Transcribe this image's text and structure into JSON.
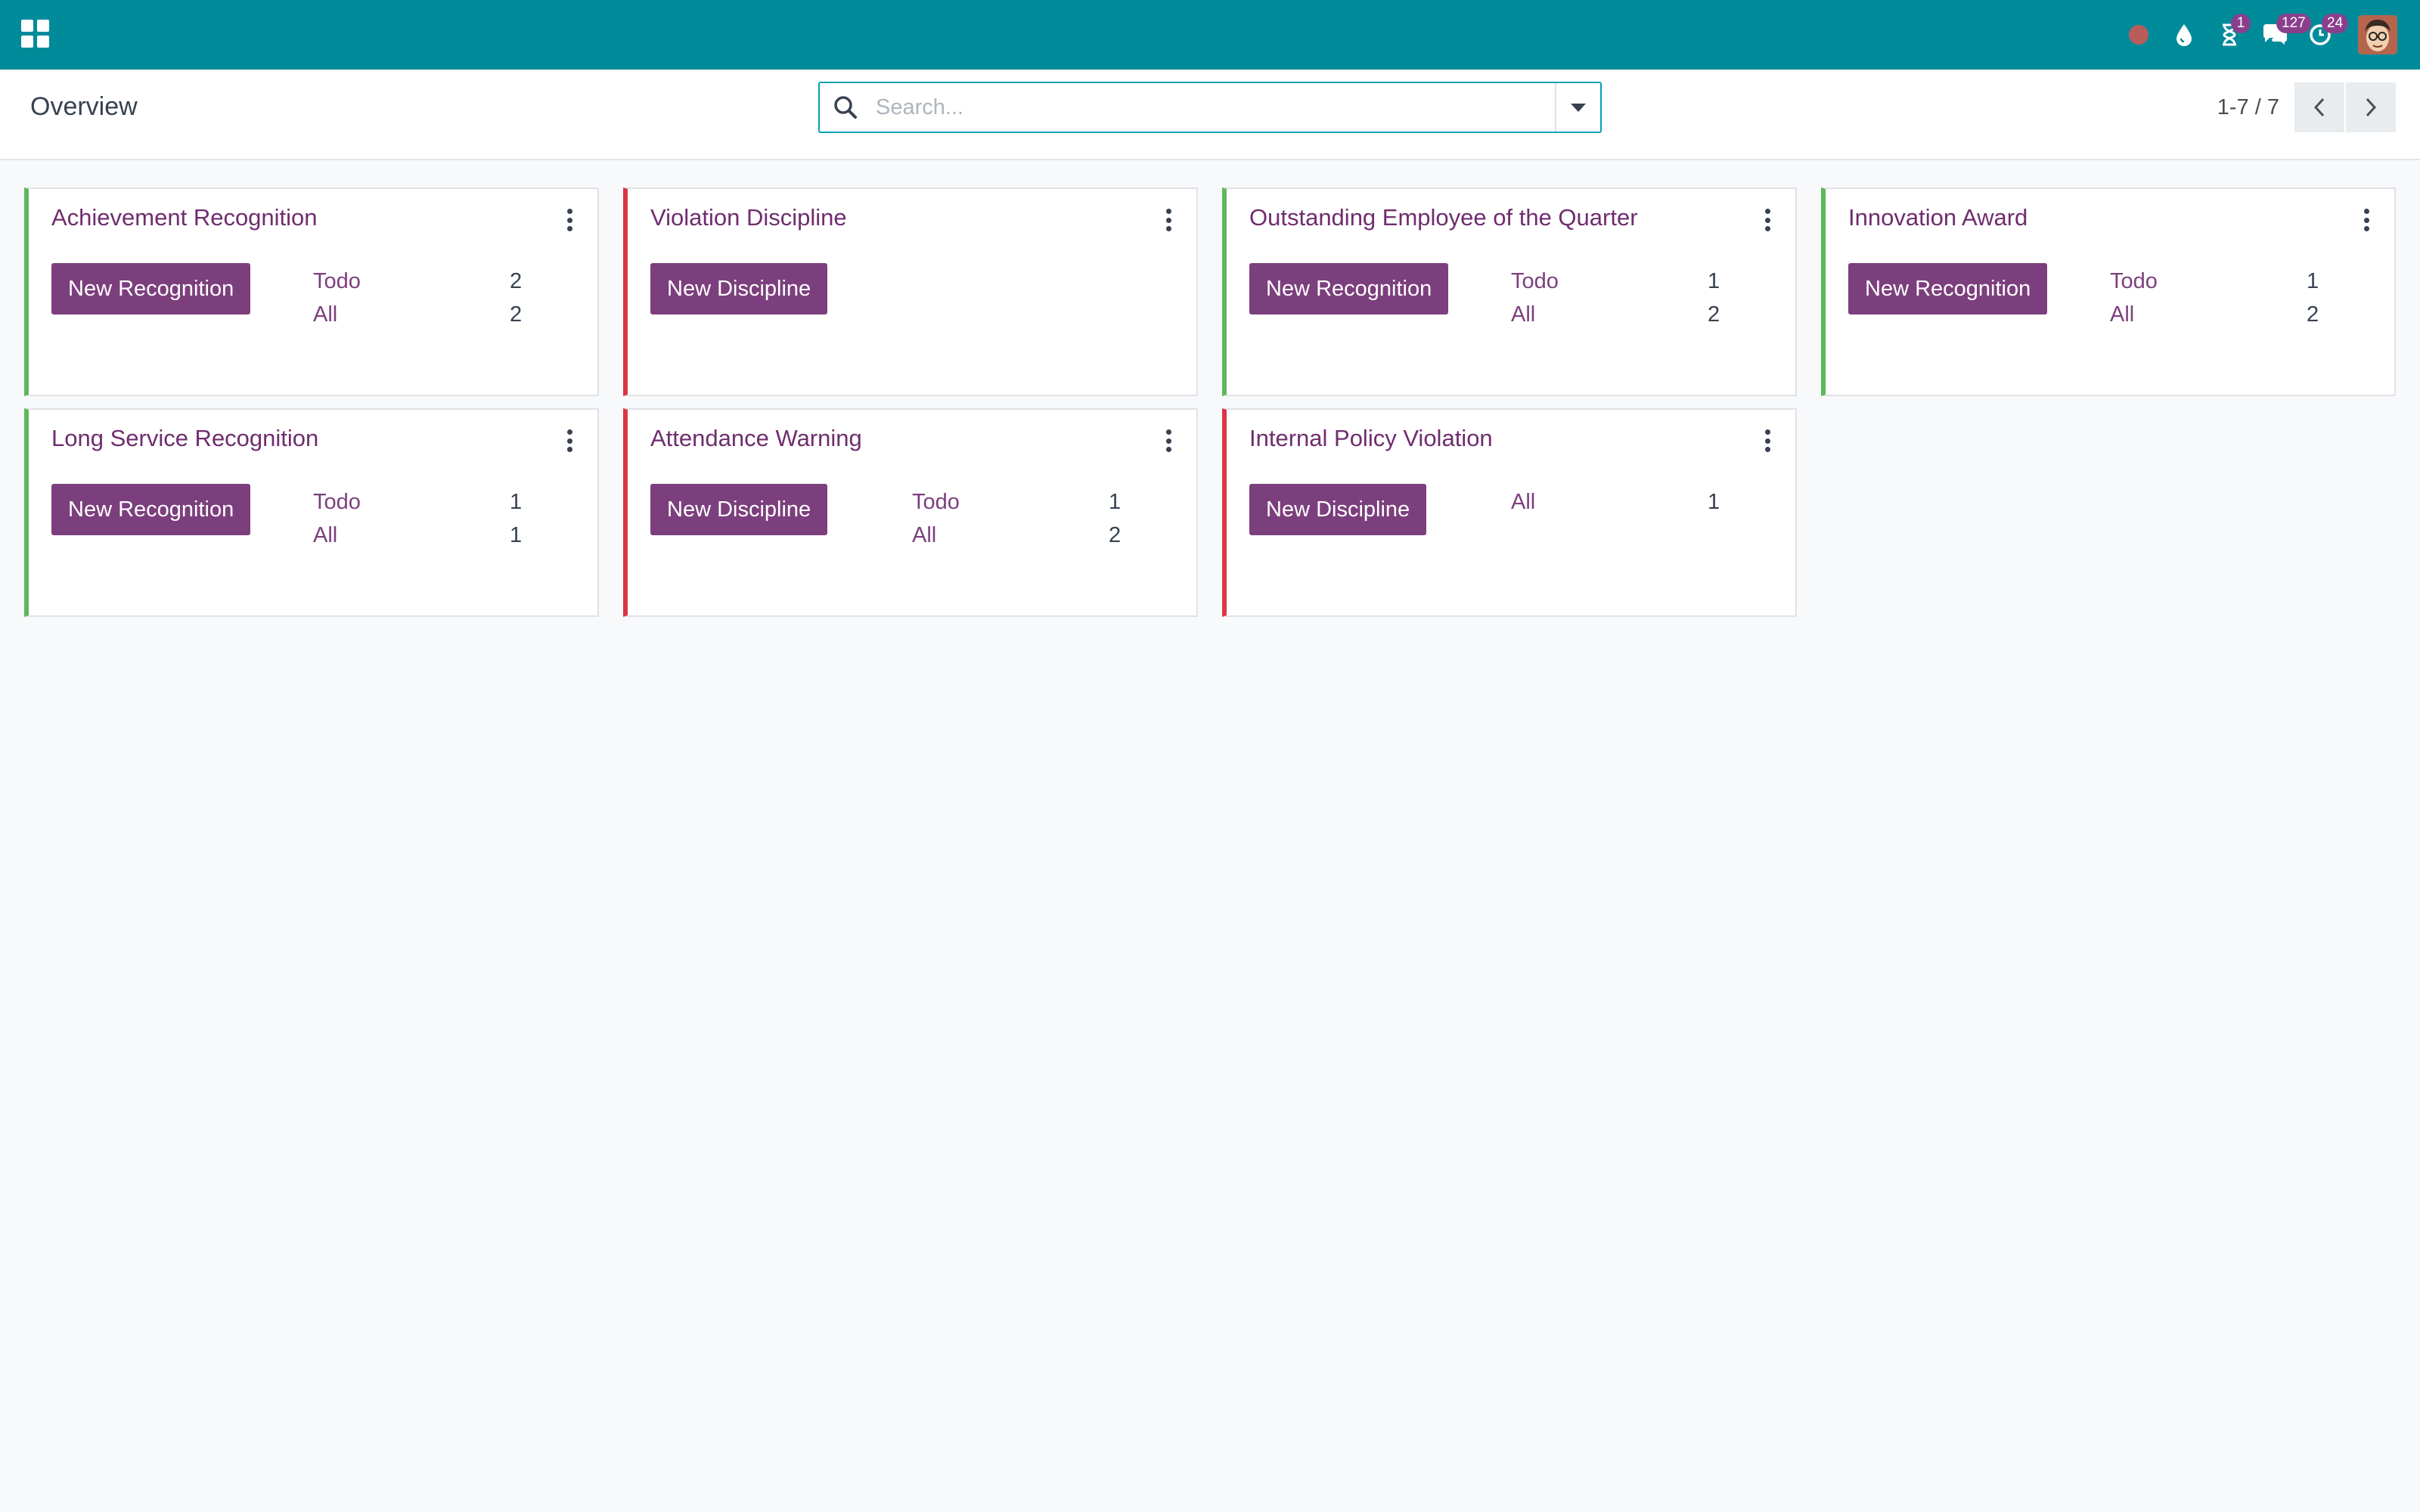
{
  "navbar": {
    "apps_icon": "apps-grid-icon",
    "systray": [
      {
        "name": "recording-dot-icon"
      },
      {
        "name": "water-drop-icon"
      },
      {
        "name": "hourglass-icon",
        "badge": "1"
      },
      {
        "name": "chat-icon",
        "badge": "127"
      },
      {
        "name": "activity-clock-icon",
        "badge": "24"
      }
    ],
    "avatar": "user-avatar"
  },
  "control_panel": {
    "breadcrumb": "Overview",
    "search_placeholder": "Search...",
    "pager": "1-7 / 7"
  },
  "colors": {
    "navbar": "#008b9a",
    "button": "#7c3f7d",
    "green_border": "#5cb85c",
    "red_border": "#dc3545"
  },
  "cards": [
    {
      "title": "Achievement Recognition",
      "color": "green",
      "button": "New Recognition",
      "stats": [
        {
          "label": "Todo",
          "value": "2"
        },
        {
          "label": "All",
          "value": "2"
        }
      ]
    },
    {
      "title": "Violation Discipline",
      "color": "red",
      "button": "New Discipline",
      "stats": []
    },
    {
      "title": "Outstanding Employee of the Quarter",
      "color": "green",
      "button": "New Recognition",
      "stats": [
        {
          "label": "Todo",
          "value": "1"
        },
        {
          "label": "All",
          "value": "2"
        }
      ]
    },
    {
      "title": "Innovation Award",
      "color": "green",
      "button": "New Recognition",
      "stats": [
        {
          "label": "Todo",
          "value": "1"
        },
        {
          "label": "All",
          "value": "2"
        }
      ]
    },
    {
      "title": "Long Service Recognition",
      "color": "green",
      "button": "New Recognition",
      "stats": [
        {
          "label": "Todo",
          "value": "1"
        },
        {
          "label": "All",
          "value": "1"
        }
      ]
    },
    {
      "title": "Attendance Warning",
      "color": "red",
      "button": "New Discipline",
      "stats": [
        {
          "label": "Todo",
          "value": "1"
        },
        {
          "label": "All",
          "value": "2"
        }
      ]
    },
    {
      "title": "Internal Policy Violation",
      "color": "red",
      "button": "New Discipline",
      "stats": [
        {
          "label": "All",
          "value": "1"
        }
      ]
    }
  ]
}
